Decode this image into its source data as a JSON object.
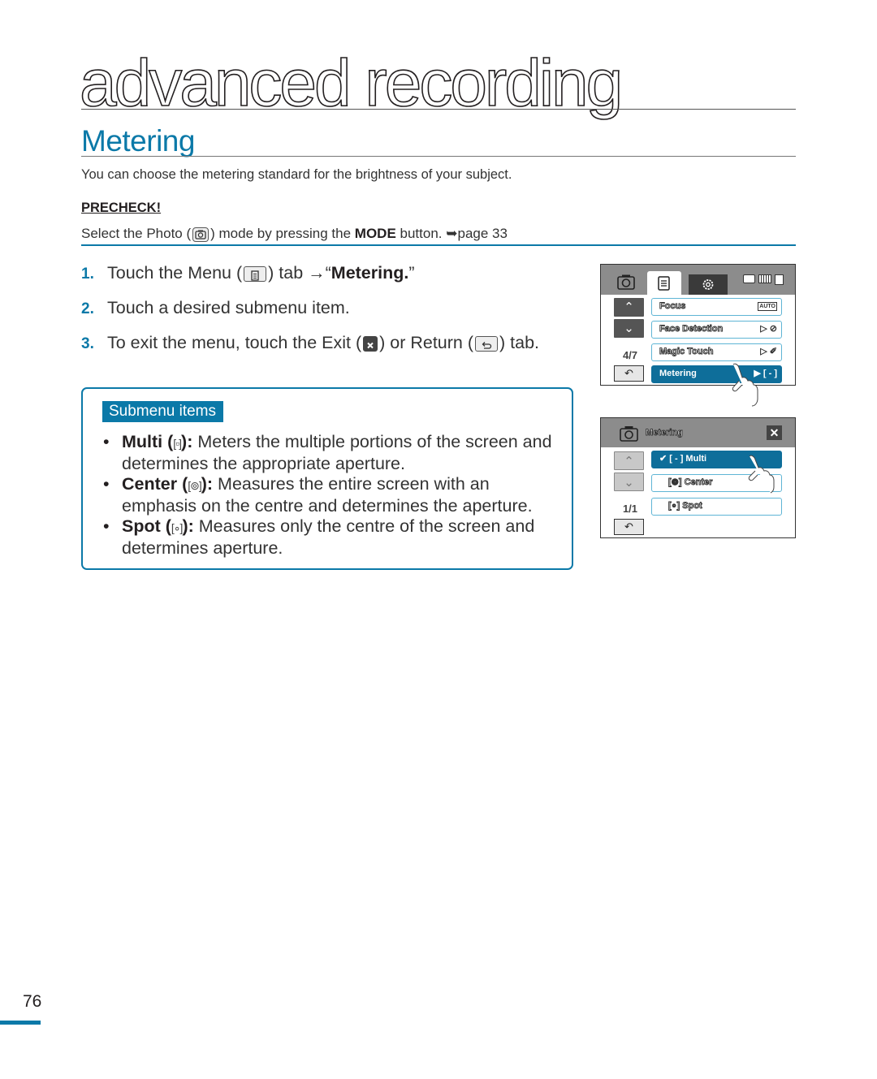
{
  "header": {
    "chapter_title": "advanced recording",
    "section_title": "Metering"
  },
  "intro": "You can choose the metering standard for the brightness of your subject.",
  "precheck": {
    "label": "PRECHECK!",
    "text_before": "Select the Photo (",
    "text_middle": ") mode by pressing the ",
    "mode_word": "MODE",
    "text_after": " button. ",
    "page_ref": "page 33",
    "arrow": "➥"
  },
  "steps": [
    {
      "num": "1.",
      "before": "Touch the Menu (",
      "after": ") tab →“",
      "bold": "Metering.",
      "tail": "”"
    },
    {
      "num": "2.",
      "text": "Touch a desired submenu item."
    },
    {
      "num": "3.",
      "before": "To exit the menu, touch the Exit (",
      "mid": ") or Return (",
      "after": ") tab."
    }
  ],
  "submenu": {
    "tag": "Submenu items",
    "items": [
      {
        "name": "Multi (",
        "icon": "[▫]",
        "close": "):",
        "desc": " Meters the multiple portions of the screen and determines the appropriate aperture."
      },
      {
        "name": "Center (",
        "icon": "[⊚]",
        "close": "):",
        "desc": " Measures the entire screen with an emphasis on the centre and determines the aperture."
      },
      {
        "name": "Spot (",
        "icon": "[∘]",
        "close": "):",
        "desc": " Measures only the centre of the screen and determines aperture."
      }
    ]
  },
  "screen1": {
    "counter": "4/7",
    "items": [
      {
        "label": "Focus",
        "value": "AUTO"
      },
      {
        "label": "Face Detection",
        "value": "▷ ⊘"
      },
      {
        "label": "Magic Touch",
        "value": "▷ ✐"
      },
      {
        "label": "Metering",
        "value": "▶ [ - ]",
        "selected": true
      }
    ],
    "up": "⌃",
    "down": "⌄",
    "return": "↶"
  },
  "screen2": {
    "title": "Metering",
    "close": "✕",
    "counter": "1/1",
    "items": [
      {
        "label": "✔ [ - ]  Multi",
        "selected": true
      },
      {
        "label": "[⊚]  Center"
      },
      {
        "label": "[∘]  Spot"
      }
    ],
    "up": "⌃",
    "down": "⌄",
    "return": "↶"
  },
  "page_number": "76",
  "colors": {
    "accent": "#0b79a8",
    "selected_item": "#0e6e9a",
    "screen_bar": "#8c8c8c"
  }
}
